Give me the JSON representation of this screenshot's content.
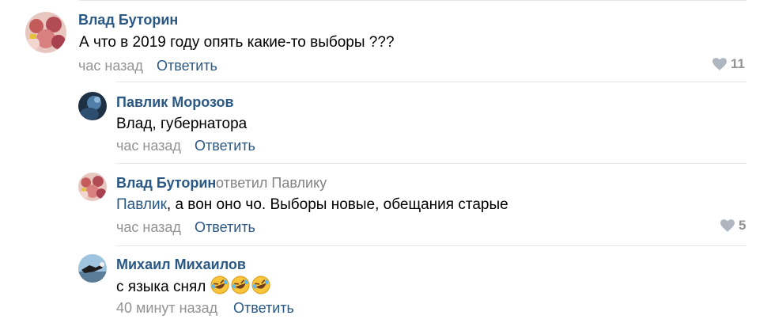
{
  "comments": [
    {
      "author": "Влад Буторин",
      "text": "А что в 2019 году опять какие-то выборы ???",
      "time": "час назад",
      "reply_label": "Ответить",
      "likes": "11",
      "avatar_icon": "user-photo-avatar"
    },
    {
      "author": "Павлик Морозов",
      "text": "Влад, губернатора",
      "time": "час назад",
      "reply_label": "Ответить",
      "avatar_icon": "user-photo-avatar"
    },
    {
      "author": "Влад Буторин",
      "replied_to": "ответил Павлику",
      "mention": "Павлик",
      "text": ", а вон оно чо. Выборы новые, обещания старые",
      "time": "час назад",
      "reply_label": "Ответить",
      "likes": "5",
      "avatar_icon": "user-photo-avatar"
    },
    {
      "author": "Михаил Михаилов",
      "text": "с языка снял",
      "emoji": [
        "rolling-on-floor-laughing-emoji",
        "rolling-on-floor-laughing-emoji",
        "rolling-on-floor-laughing-emoji"
      ],
      "time": "40 минут назад",
      "reply_label": "Ответить",
      "avatar_icon": "user-photo-avatar"
    }
  ],
  "colors": {
    "link": "#2a5885",
    "muted": "#939393",
    "divider": "#e7e8ec"
  }
}
